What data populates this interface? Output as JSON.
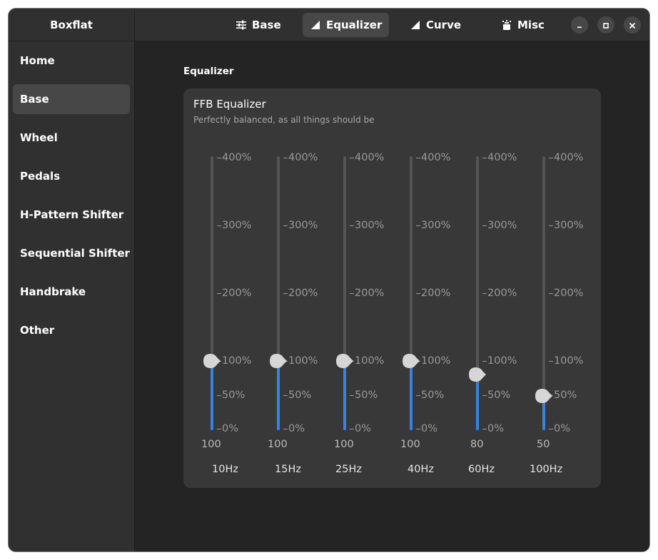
{
  "app": {
    "title": "Boxflat"
  },
  "sidebar": {
    "items": [
      {
        "label": "Home"
      },
      {
        "label": "Base"
      },
      {
        "label": "Wheel"
      },
      {
        "label": "Pedals"
      },
      {
        "label": "H-Pattern Shifter"
      },
      {
        "label": "Sequential Shifter"
      },
      {
        "label": "Handbrake"
      },
      {
        "label": "Other"
      }
    ],
    "active": "Base"
  },
  "tabs": [
    {
      "label": "Base",
      "icon": "sliders-icon"
    },
    {
      "label": "Equalizer",
      "icon": "triangle-ramp-icon"
    },
    {
      "label": "Curve",
      "icon": "triangle-ramp-icon"
    },
    {
      "label": "Misc",
      "icon": "misc-icon"
    }
  ],
  "active_tab": "Equalizer",
  "window_controls": [
    "minimize-icon",
    "maximize-icon",
    "close-icon"
  ],
  "section": {
    "title": "Equalizer"
  },
  "card": {
    "title": "FFB Equalizer",
    "subtitle": "Perfectly balanced, as all things should be"
  },
  "scale_marks": [
    "400%",
    "300%",
    "200%",
    "100%",
    "50%",
    "0%"
  ],
  "sliders": [
    {
      "freq": "10Hz",
      "value": "100"
    },
    {
      "freq": "15Hz",
      "value": "100"
    },
    {
      "freq": "25Hz",
      "value": "100"
    },
    {
      "freq": "40Hz",
      "value": "100"
    },
    {
      "freq": "60Hz",
      "value": "80"
    },
    {
      "freq": "100Hz",
      "value": "50"
    }
  ],
  "colors": {
    "accent": "#3584e4",
    "knob": "#d6d6d6"
  }
}
